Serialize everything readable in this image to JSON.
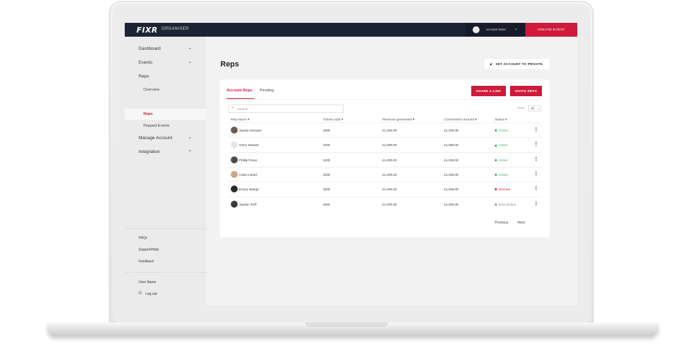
{
  "topbar": {
    "logo": "FIXR",
    "section": "ORGANISER",
    "account_name": "Account name",
    "create_event": "CREATE EVENT"
  },
  "sidebar": {
    "dashboard": "Dashboard",
    "events": "Events",
    "reps": "Reps",
    "reps_sub": [
      "Overview",
      "Reps",
      "Repped Events"
    ],
    "manage_account": "Manage Account",
    "integration": "Integration",
    "footer": [
      "FAQs",
      "Support/Help",
      "Feedback"
    ],
    "user_name": "User Name",
    "logout": "Log out"
  },
  "main": {
    "title": "Reps",
    "private_button": "SET ACCOUNT TO PRIVATE",
    "tabs": [
      "Account Reps",
      "Pending"
    ],
    "share_link": "SHARE A LINK",
    "invite_reps": "INVITE REPS",
    "search_placeholder": "Search",
    "show_label": "Show",
    "show_value": "10",
    "columns": [
      "Rep Name",
      "Tickets sold",
      "Revenue generated",
      "Commission Earned",
      "Status"
    ],
    "rows": [
      {
        "name": "Jaydon Dorwart",
        "tickets": "1000",
        "revenue": "£1,000.00",
        "commission": "£1,000.00",
        "status": "Active"
      },
      {
        "name": "Gerry Stewart",
        "tickets": "1000",
        "revenue": "£1,000.00",
        "commission": "£1,000.00",
        "status": "Active"
      },
      {
        "name": "Phillip Franci",
        "tickets": "1000",
        "revenue": "£1,000.00",
        "commission": "£1,000.00",
        "status": "Active"
      },
      {
        "name": "Carla Carder",
        "tickets": "1000",
        "revenue": "£1,000.00",
        "commission": "£1,000.00",
        "status": "Active"
      },
      {
        "name": "Emery Mango",
        "tickets": "1000",
        "revenue": "£1,000.00",
        "commission": "£1,000.00",
        "status": "Banned"
      },
      {
        "name": "Jaydon Torff",
        "tickets": "1000",
        "revenue": "£1,000.00",
        "commission": "£1,000.00",
        "status": "Deactivated"
      }
    ],
    "previous": "Previous",
    "next": "Next"
  },
  "colors": {
    "brand_red": "#cf1a3b",
    "topbar": "#1d2435",
    "active": "#2eaf55",
    "banned": "#d0233f",
    "deactivated": "#8a8a8a"
  }
}
